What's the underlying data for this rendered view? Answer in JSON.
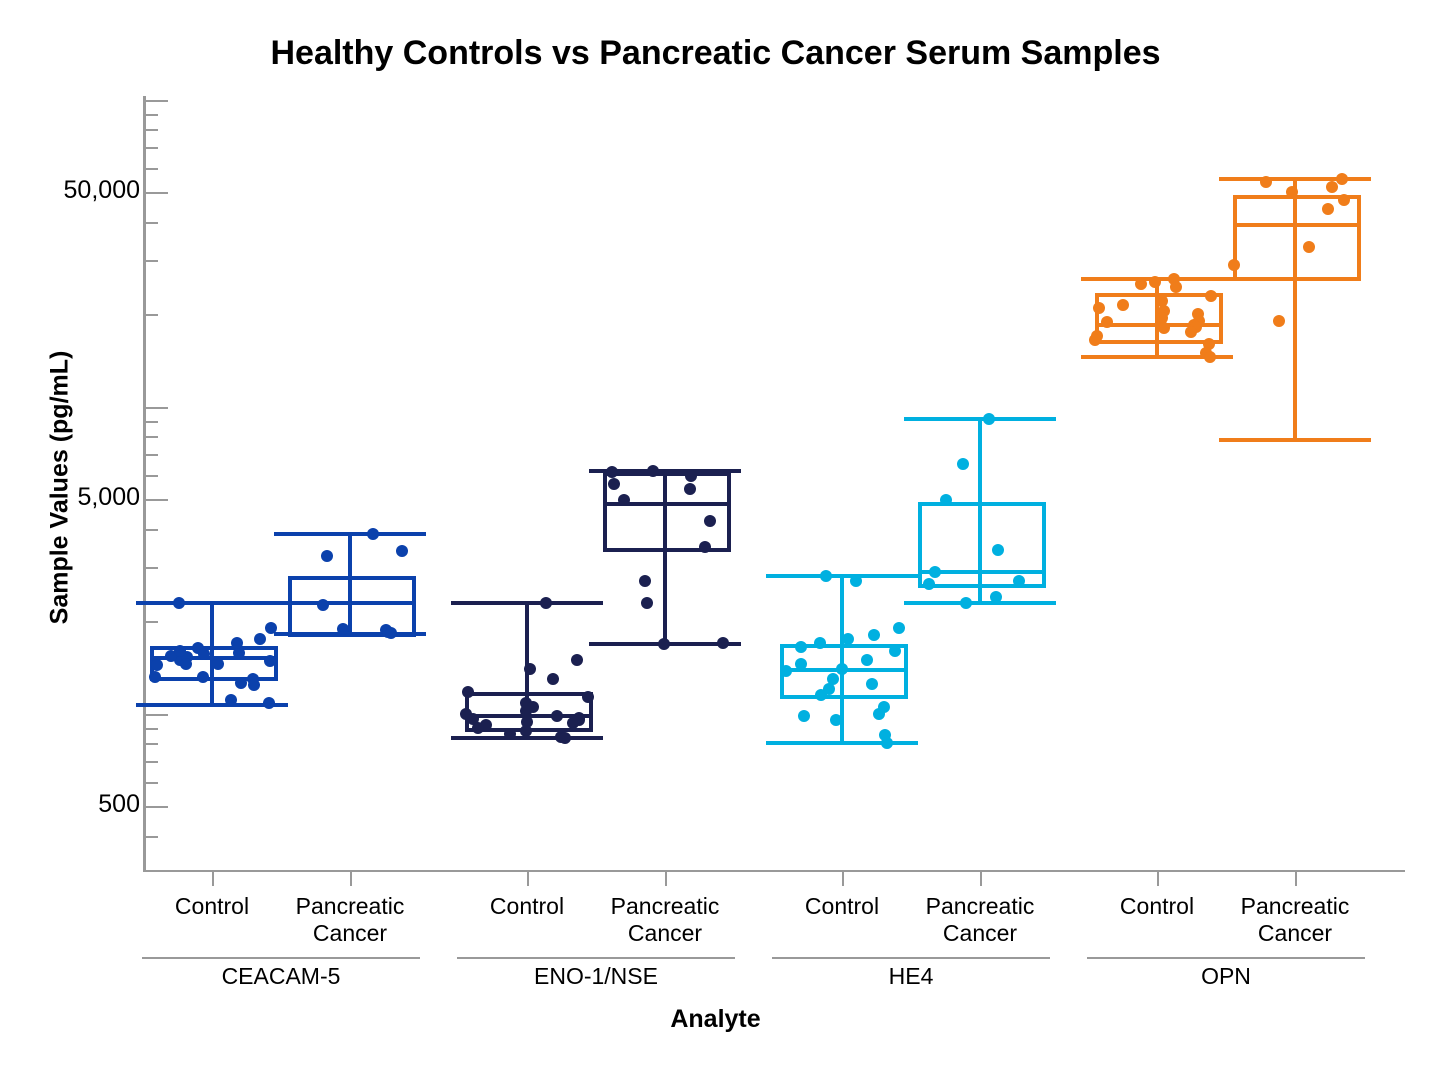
{
  "chart_data": {
    "type": "box",
    "title": "Healthy Controls vs Pancreatic Cancer Serum Samples",
    "xlabel": "Analyte",
    "ylabel": "Sample Values (pg/mL)",
    "yscale": "log",
    "ylim": [
      330,
      120000
    ],
    "ytick_labels": [
      "50,000",
      "5,000",
      "500"
    ],
    "ytick_values": [
      50000,
      5000,
      500
    ],
    "grid": false,
    "legend": "none",
    "categories": [
      "CEACAM-5",
      "ENO-1/NSE",
      "HE4",
      "OPN"
    ],
    "conditions": [
      "Control",
      "Pancreatic Cancer"
    ],
    "groups": [
      {
        "analyte": "CEACAM-5",
        "color": "#0b41ac",
        "boxes": [
          {
            "condition": "Control",
            "whisker_low": 1070,
            "q1": 1320,
            "median": 1520,
            "q3": 1660,
            "whisker_high": 2300,
            "points": [
              1490,
              1320,
              1540,
              1530,
              1450,
              1440,
              1320,
              1580,
              1600,
              1630,
              1480,
              1260,
              1300,
              1560,
              1750,
              1240,
              1080,
              1110,
              2300,
              1900,
              1700,
              1450
            ]
          },
          {
            "condition": "Pancreatic Cancer",
            "whisker_low": 1810,
            "q1": 1830,
            "median": 2290,
            "q3": 2800,
            "whisker_high": 3850,
            "points": [
              3850,
              3380,
              3250,
              1870,
              1840,
              1830,
              2260,
              1880
            ]
          }
        ]
      },
      {
        "analyte": "ENO-1/NSE",
        "color": "#1b2050",
        "boxes": [
          {
            "condition": "Control",
            "whisker_low": 830,
            "q1": 900,
            "median": 980,
            "q3": 1180,
            "whisker_high": 2300,
            "points": [
              2300,
              1500,
              1400,
              1300,
              1180,
              1130,
              1080,
              1050,
              1020,
              1000,
              980,
              970,
              960,
              950,
              940,
              930,
              920,
              900,
              880,
              860,
              840,
              830
            ]
          },
          {
            "condition": "Pancreatic Cancer",
            "whisker_low": 1680,
            "q1": 3450,
            "median": 4800,
            "q3": 6100,
            "whisker_high": 6150,
            "points": [
              6150,
              6100,
              5950,
              5600,
              5400,
              4950,
              4250,
              3500,
              2700,
              2300,
              1700,
              1680
            ]
          }
        ]
      },
      {
        "analyte": "HE4",
        "color": "#00b0e0",
        "boxes": [
          {
            "condition": "Control",
            "whisker_low": 800,
            "q1": 1150,
            "median": 1390,
            "q3": 1680,
            "whisker_high": 2800,
            "points": [
              2800,
              2700,
              1900,
              1800,
              1750,
              1700,
              1650,
              1600,
              1500,
              1450,
              1400,
              1380,
              1300,
              1250,
              1200,
              1150,
              1050,
              1000,
              980,
              950,
              850,
              800
            ]
          },
          {
            "condition": "Pancreatic Cancer",
            "whisker_low": 2300,
            "q1": 2650,
            "median": 2900,
            "q3": 4900,
            "whisker_high": 9100,
            "points": [
              9100,
              6500,
              4950,
              3400,
              2900,
              2700,
              2650,
              2400,
              2300
            ]
          }
        ]
      },
      {
        "analyte": "OPN",
        "color": "#f07d1a",
        "boxes": [
          {
            "condition": "Control",
            "whisker_low": 14500,
            "q1": 16500,
            "median": 18500,
            "q3": 23500,
            "whisker_high": 26000,
            "points": [
              26000,
              25500,
              25000,
              24500,
              23000,
              22000,
              21500,
              21000,
              20500,
              20000,
              19500,
              19000,
              18800,
              18500,
              18200,
              18000,
              17500,
              17000,
              16500,
              16000,
              15000,
              14500
            ]
          },
          {
            "condition": "Pancreatic Cancer",
            "whisker_low": 7800,
            "q1": 26500,
            "median": 39000,
            "q3": 49000,
            "whisker_high": 55000,
            "points": [
              55000,
              54000,
              52000,
              50000,
              47000,
              44000,
              33000,
              29000,
              19000
            ]
          }
        ]
      }
    ]
  }
}
